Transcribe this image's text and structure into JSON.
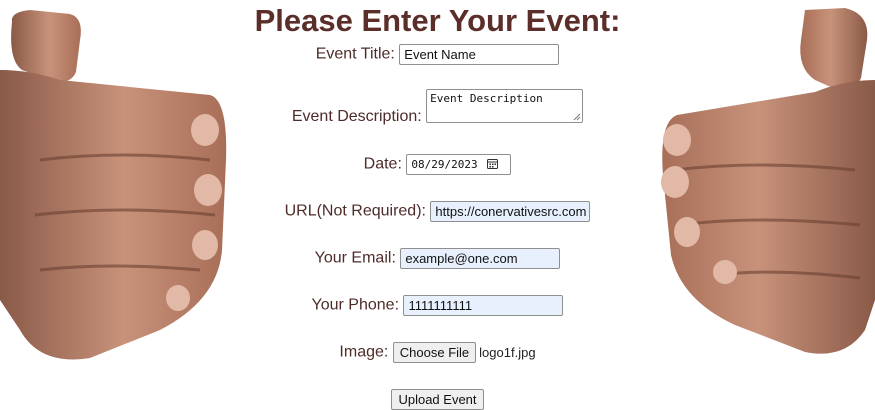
{
  "page": {
    "title": "Please Enter Your Event:"
  },
  "form": {
    "event_title": {
      "label": "Event Title:",
      "value": "Event Name"
    },
    "event_description": {
      "label": "Event Description:",
      "value": "Event Description"
    },
    "date": {
      "label": "Date:",
      "value": "08/29/2023",
      "icon": "calendar-icon"
    },
    "url": {
      "label": "URL(Not Required):",
      "value": "https://conervativesrc.com"
    },
    "email": {
      "label": "Your Email:",
      "value": "example@one.com"
    },
    "phone": {
      "label": "Your Phone:",
      "value": "1111111111"
    },
    "image": {
      "label": "Image:",
      "button_label": "Choose File",
      "file_name": "logo1f.jpg"
    },
    "submit_label": "Upload Event"
  },
  "colors": {
    "heading": "#5c2e2a",
    "label": "#4d2c29",
    "autofill": "#e8f0fe"
  }
}
